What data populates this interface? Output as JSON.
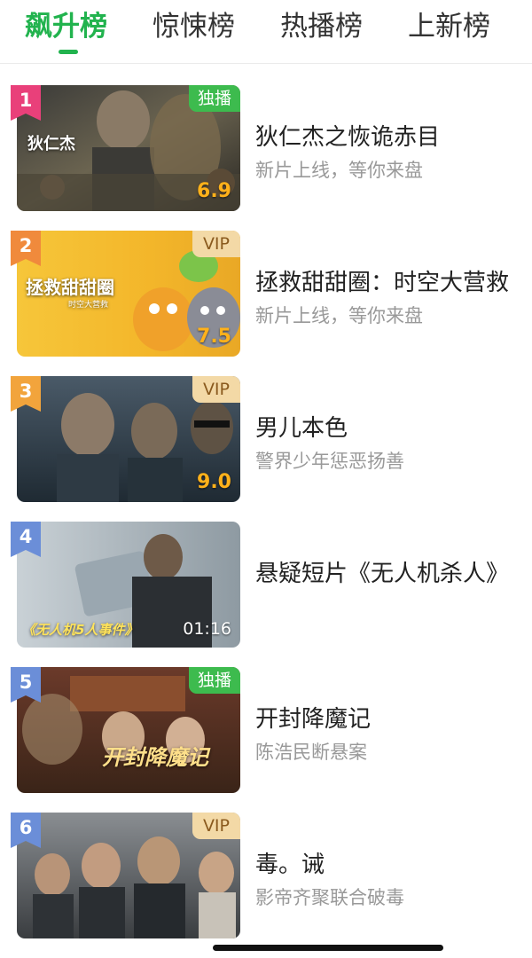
{
  "tabs": [
    {
      "label": "飙升榜",
      "active": true
    },
    {
      "label": "惊悚榜",
      "active": false
    },
    {
      "label": "热播榜",
      "active": false
    },
    {
      "label": "上新榜",
      "active": false
    }
  ],
  "colors": {
    "accent": "#22b34e",
    "exclusive_badge": "#3dbb4e",
    "vip_badge": "#f3d9a6",
    "score": "#ffb11a",
    "rank_1": "#e9407a",
    "rank_2": "#f08a3c",
    "rank_3": "#f2a43c",
    "rank_other": "#6b8ed8"
  },
  "items": [
    {
      "rank": "1",
      "badge": "独播",
      "badge_type": "exclusive",
      "score": "6.9",
      "title": "狄仁杰之恢诡赤目",
      "subtitle": "新片上线，等你来盘",
      "poster_text": "狄仁杰"
    },
    {
      "rank": "2",
      "badge": "VIP",
      "badge_type": "vip",
      "score": "7.5",
      "title": "拯救甜甜圈：时空大营救",
      "subtitle": "新片上线，等你来盘",
      "poster_text": "拯救甜甜圈",
      "poster_subtext": "时空大营救"
    },
    {
      "rank": "3",
      "badge": "VIP",
      "badge_type": "vip",
      "score": "9.0",
      "title": "男儿本色",
      "subtitle": "警界少年惩恶扬善"
    },
    {
      "rank": "4",
      "duration": "01:16",
      "title": "悬疑短片《无人机杀人》",
      "subtitle": "",
      "poster_text": "《无人机5人事件》"
    },
    {
      "rank": "5",
      "badge": "独播",
      "badge_type": "exclusive",
      "title": "开封降魔记",
      "subtitle": "陈浩民断悬案",
      "poster_text": "开封降魔记"
    },
    {
      "rank": "6",
      "badge": "VIP",
      "badge_type": "vip",
      "title": "毒。诫",
      "subtitle": "影帝齐聚联合破毒"
    }
  ]
}
